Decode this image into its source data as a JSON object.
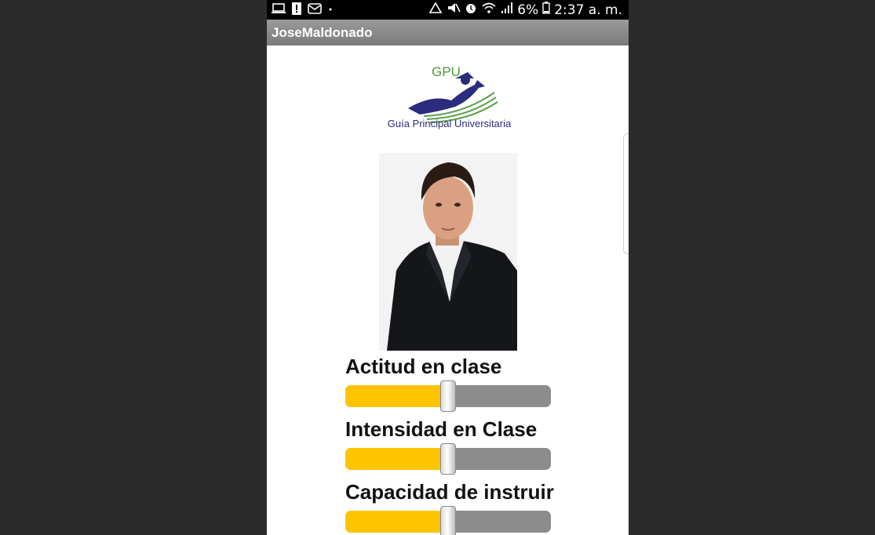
{
  "status_bar": {
    "left_icons": [
      "laptop-icon",
      "alert-icon",
      "mail-icon",
      "dot-icon"
    ],
    "right_icons": [
      "recycle-icon",
      "mute-icon",
      "alarm-icon",
      "wifi-icon",
      "signal-icon",
      "battery-icon"
    ],
    "battery": "6%",
    "time": "2:37 a. m."
  },
  "app": {
    "title": "JoseMaldonado"
  },
  "logo": {
    "acronym": "GPU",
    "name": "Guía Principal Universitaria"
  },
  "ratings": [
    {
      "label": "Actitud en clase",
      "value": 0.5
    },
    {
      "label": "Intensidad en Clase",
      "value": 0.5
    },
    {
      "label": "Capacidad de instruir",
      "value": 0.5
    }
  ],
  "colors": {
    "fill": "#ffc400",
    "track": "#8c8c8c",
    "background": "#2b2b2b"
  }
}
